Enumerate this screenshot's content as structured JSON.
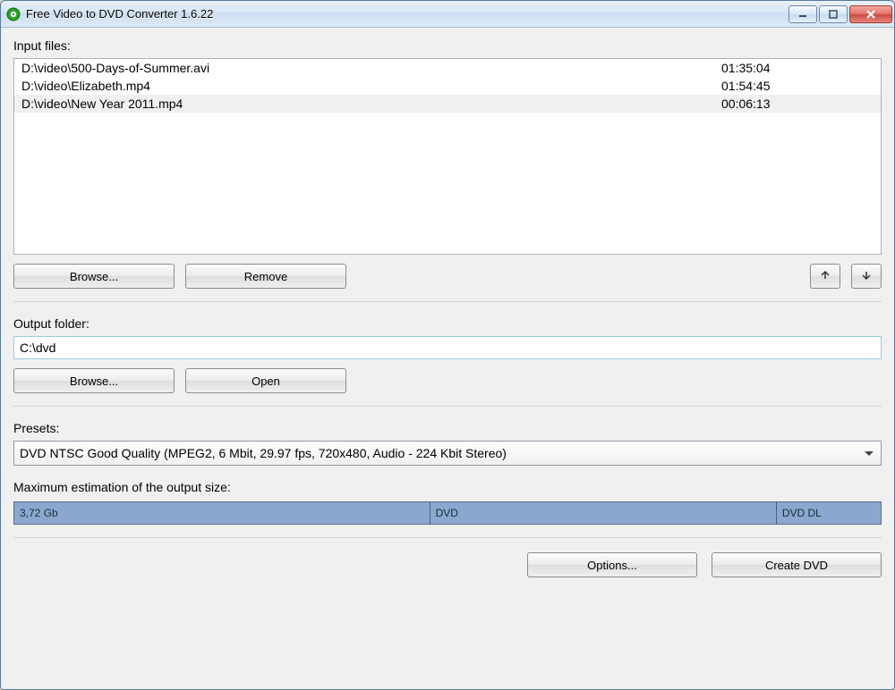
{
  "titlebar": {
    "title": "Free Video to DVD Converter 1.6.22"
  },
  "input_section": {
    "label": "Input files:",
    "files": [
      {
        "path": "D:\\video\\500-Days-of-Summer.avi",
        "duration": "01:35:04",
        "selected": false
      },
      {
        "path": "D:\\video\\Elizabeth.mp4",
        "duration": "01:54:45",
        "selected": false
      },
      {
        "path": "D:\\video\\New Year 2011.mp4",
        "duration": "00:06:13",
        "selected": true
      }
    ],
    "browse_label": "Browse...",
    "remove_label": "Remove"
  },
  "output_section": {
    "label": "Output folder:",
    "value": "C:\\dvd",
    "browse_label": "Browse...",
    "open_label": "Open"
  },
  "presets": {
    "label": "Presets:",
    "selected": "DVD NTSC Good Quality (MPEG2, 6 Mbit, 29.97 fps, 720x480, Audio - 224 Kbit Stereo)"
  },
  "output_size": {
    "label": "Maximum estimation of the output size:",
    "segments": [
      {
        "label": "3,72 Gb",
        "width_pct": 48
      },
      {
        "label": "DVD",
        "width_pct": 40
      },
      {
        "label": "DVD DL",
        "width_pct": 12
      }
    ]
  },
  "bottom": {
    "options_label": "Options...",
    "create_label": "Create DVD"
  }
}
